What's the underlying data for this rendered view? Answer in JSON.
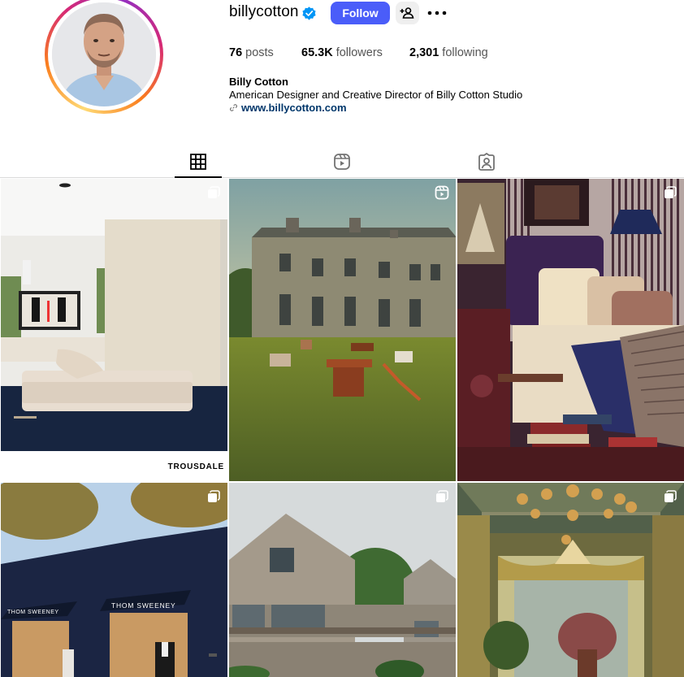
{
  "profile": {
    "username": "billycotton",
    "follow_label": "Follow",
    "stats": {
      "posts_count": "76",
      "posts_label": "posts",
      "followers_count": "65.3K",
      "followers_label": "followers",
      "following_count": "2,301",
      "following_label": "following"
    },
    "bio": {
      "name": "Billy Cotton",
      "description": "American Designer and Creative Director of Billy Cotton Studio",
      "link": "www.billycotton.com"
    }
  },
  "tabs": [
    {
      "icon": "grid-icon",
      "active": true
    },
    {
      "icon": "reels-icon",
      "active": false
    },
    {
      "icon": "tagged-icon",
      "active": false
    }
  ],
  "posts": [
    {
      "type": "carousel",
      "caption_text": "TROUSDALE"
    },
    {
      "type": "reel"
    },
    {
      "type": "carousel"
    },
    {
      "type": "carousel"
    },
    {
      "type": "carousel"
    },
    {
      "type": "carousel"
    }
  ],
  "colors": {
    "follow_button": "#4a5df9",
    "link": "#00376b",
    "verified": "#0095f6"
  }
}
